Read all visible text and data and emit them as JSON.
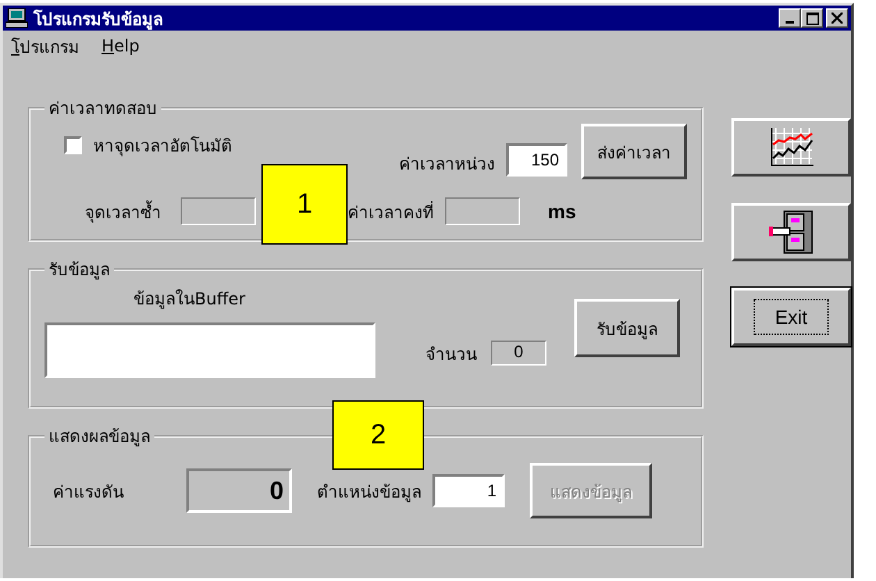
{
  "window": {
    "title": "โปรแกรมรับข้อมูล"
  },
  "menu": [
    {
      "label": "โปรแกรม"
    },
    {
      "label": "Help"
    }
  ],
  "time_group": {
    "title": "ค่าเวลาทดสอบ",
    "auto_checkbox": {
      "label": "หาจุดเวลาอัตโนมัติ",
      "checked": false
    },
    "delay": {
      "label": "ค่าเวลาหน่วง",
      "value": "150"
    },
    "send_button": "ส่งค่าเวลา",
    "repeat_point": {
      "label": "จุดเวลาซ้ำ"
    },
    "constant": {
      "label": "ค่าเวลาคงที่"
    },
    "unit": "ms"
  },
  "receive_group": {
    "title": "รับข้อมูล",
    "buffer_label": "ข้อมูลในBuffer",
    "count": {
      "label": "จำนวน",
      "value": "0"
    },
    "receive_button": "รับข้อมูล"
  },
  "display_group": {
    "title": "แสดงผลข้อมูล",
    "voltage": {
      "label": "ค่าแรงดัน",
      "value": "0"
    },
    "position": {
      "label": "ตำแหน่งข้อมูล",
      "value": "1"
    },
    "show_button": {
      "label": "แสดงข้อมูล",
      "disabled": true
    }
  },
  "side_buttons": [
    {
      "kind": "chart"
    },
    {
      "kind": "cabinet"
    },
    {
      "kind": "text",
      "label": "Exit",
      "focused": true
    }
  ],
  "callouts": [
    {
      "label": "1"
    },
    {
      "label": "2"
    }
  ]
}
